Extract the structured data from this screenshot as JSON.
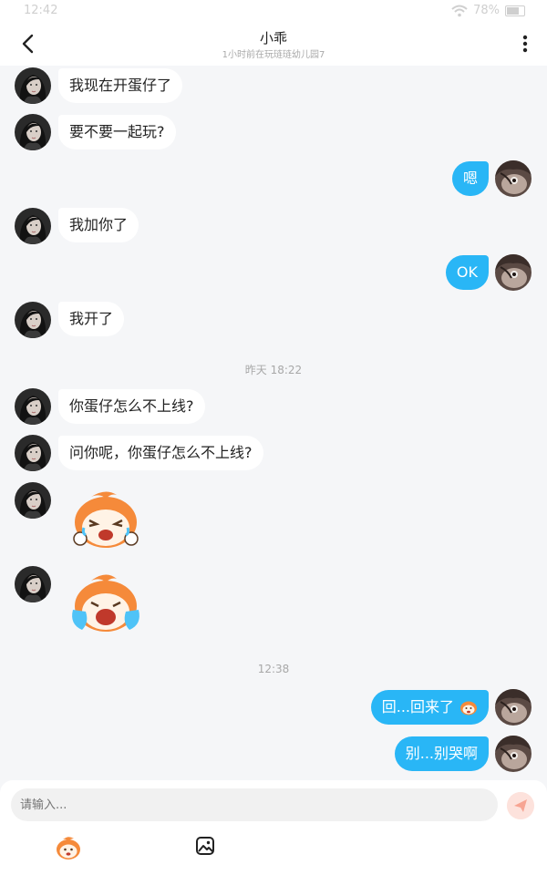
{
  "status_bar": {
    "time": "12:42",
    "battery": "78%"
  },
  "header": {
    "title": "小乖",
    "subtitle": "1小时前在玩琏琏幼儿园7"
  },
  "messages": {
    "m1": "我现在开蛋仔了",
    "m2": "要不要一起玩?",
    "m3": "嗯",
    "m4": "我加你了",
    "m5": "OK",
    "m6": "我开了",
    "ts1": "昨天 18:22",
    "m7": "你蛋仔怎么不上线?",
    "m8": "问你呢，你蛋仔怎么不上线?",
    "ts2": "12:38",
    "m9": "回...回来了",
    "m10": "别...别哭啊"
  },
  "input": {
    "placeholder": "请输入..."
  },
  "icons": {
    "back": "chevron-left-icon",
    "more": "more-vertical-icon",
    "send": "send-icon",
    "emoji": "egg-emoji-icon",
    "image": "image-icon",
    "wifi": "wifi-icon",
    "battery": "battery-icon"
  },
  "colors": {
    "accent": "#29b6f6",
    "background": "#f5f6f8",
    "sticker_orange": "#f58a3a"
  }
}
